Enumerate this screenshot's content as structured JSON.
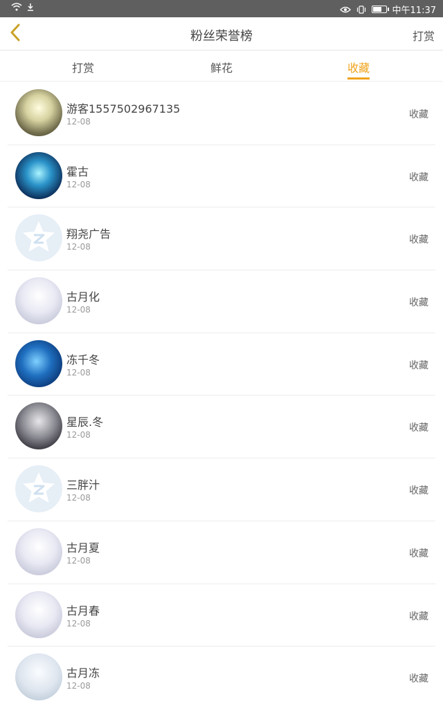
{
  "status_bar": {
    "time": "中午11:37"
  },
  "nav": {
    "title": "粉丝荣誉榜",
    "right_action": "打赏"
  },
  "tabs": [
    {
      "label": "打赏",
      "active": false
    },
    {
      "label": "鲜花",
      "active": false
    },
    {
      "label": "收藏",
      "active": true
    }
  ],
  "accent_color": "#f0a21a",
  "rows": [
    {
      "name": "游客1557502967135",
      "date": "12-08",
      "action": "收藏",
      "avatar": "avatar-image"
    },
    {
      "name": "霍古",
      "date": "12-08",
      "action": "收藏",
      "avatar": "avatar-image"
    },
    {
      "name": "翔尧广告",
      "date": "12-08",
      "action": "收藏",
      "avatar": "qq-default-avatar-icon"
    },
    {
      "name": "古月化",
      "date": "12-08",
      "action": "收藏",
      "avatar": "avatar-image"
    },
    {
      "name": "冻千冬",
      "date": "12-08",
      "action": "收藏",
      "avatar": "avatar-image"
    },
    {
      "name": "星辰.冬",
      "date": "12-08",
      "action": "收藏",
      "avatar": "avatar-image"
    },
    {
      "name": "三胖汁",
      "date": "12-08",
      "action": "收藏",
      "avatar": "qq-default-avatar-icon"
    },
    {
      "name": "古月夏",
      "date": "12-08",
      "action": "收藏",
      "avatar": "avatar-image"
    },
    {
      "name": "古月春",
      "date": "12-08",
      "action": "收藏",
      "avatar": "avatar-image"
    },
    {
      "name": "古月冻",
      "date": "12-08",
      "action": "收藏",
      "avatar": "avatar-image"
    }
  ]
}
